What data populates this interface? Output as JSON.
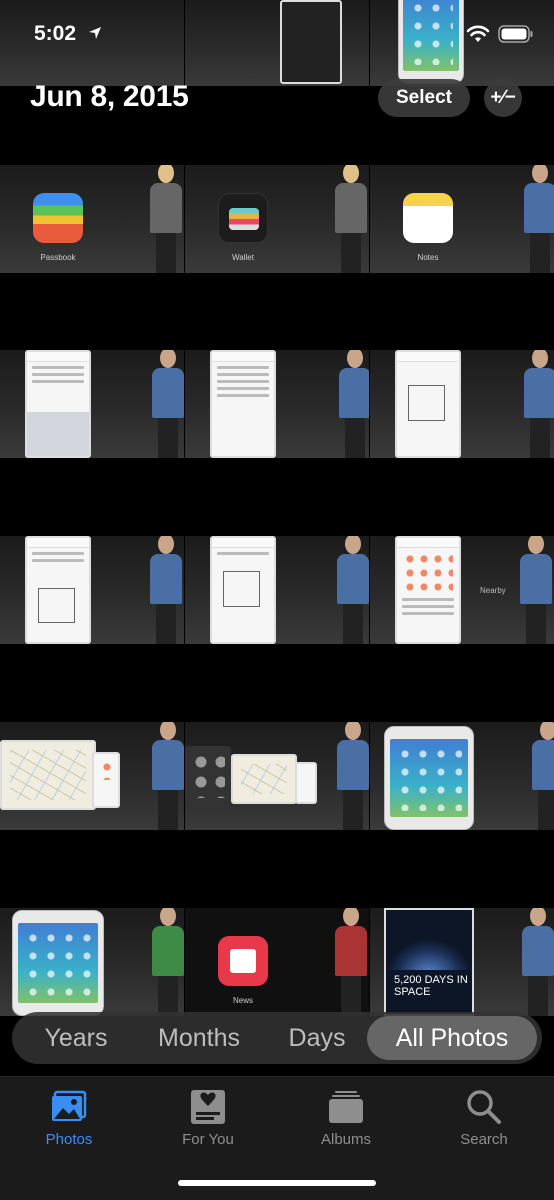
{
  "status_bar": {
    "time": "5:02"
  },
  "header": {
    "date": "Jun 8, 2015",
    "select_label": "Select",
    "aspect_label": "+∕−"
  },
  "grid": {
    "labels": {
      "passbook": "Passbook",
      "wallet": "Wallet",
      "notes": "Notes",
      "nearby": "Nearby",
      "news": "News",
      "space_title": "5,200 DAYS IN SPACE"
    }
  },
  "segments": [
    {
      "label": "Years",
      "active": false
    },
    {
      "label": "Months",
      "active": false
    },
    {
      "label": "Days",
      "active": false
    },
    {
      "label": "All Photos",
      "active": true
    }
  ],
  "tabs": [
    {
      "label": "Photos",
      "icon": "photos-icon",
      "active": true
    },
    {
      "label": "For You",
      "icon": "for-you-icon",
      "active": false
    },
    {
      "label": "Albums",
      "icon": "albums-icon",
      "active": false
    },
    {
      "label": "Search",
      "icon": "search-icon",
      "active": false
    }
  ],
  "colors": {
    "accent": "#3a8df5",
    "background": "#000000"
  }
}
